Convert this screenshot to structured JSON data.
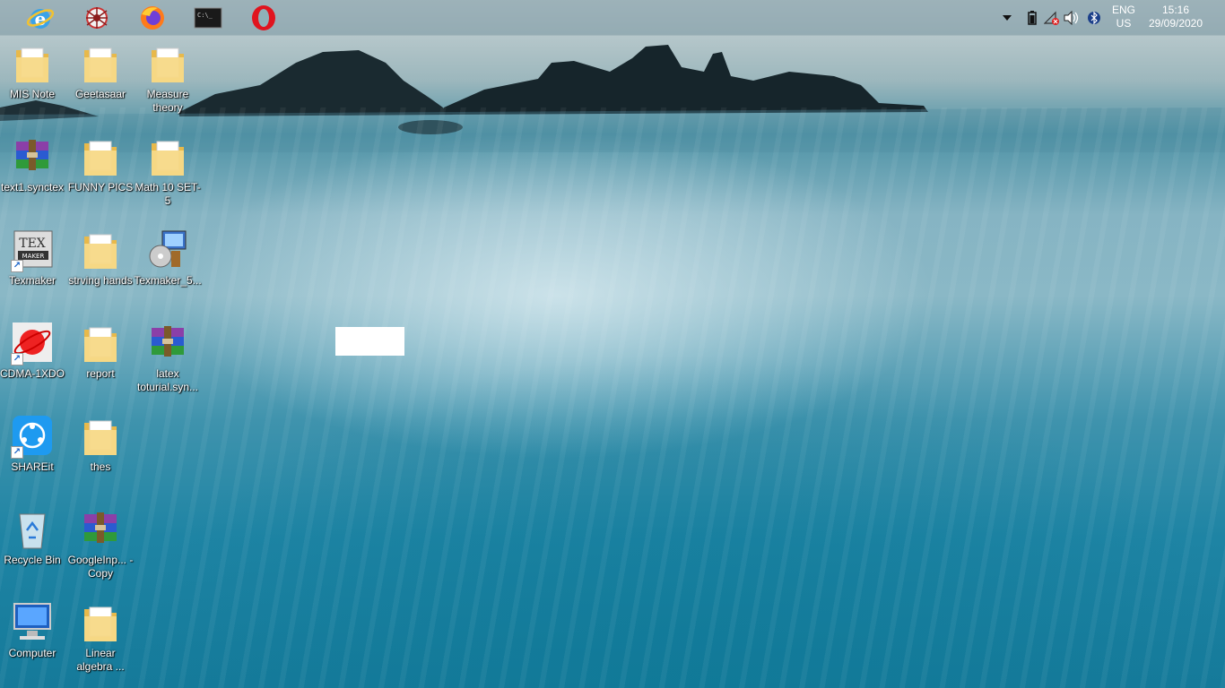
{
  "taskbar": {
    "apps": [
      {
        "name": "internet-explorer",
        "icon": "ie-icon"
      },
      {
        "name": "spider-app",
        "icon": "spider-icon"
      },
      {
        "name": "firefox",
        "icon": "firefox-icon"
      },
      {
        "name": "terminal",
        "icon": "terminal-icon"
      },
      {
        "name": "opera",
        "icon": "opera-icon"
      }
    ],
    "tray": {
      "icons": [
        "chevron-up-icon",
        "battery-icon",
        "network-disconnected-icon",
        "volume-icon",
        "bluetooth-icon"
      ],
      "lang_line1": "ENG",
      "lang_line2": "US",
      "time": "15:16",
      "date": "29/09/2020"
    }
  },
  "desktop": {
    "icons": [
      {
        "label": "MIS Note",
        "type": "folder"
      },
      {
        "label": "Geetasaar",
        "type": "folder"
      },
      {
        "label": "Measure theory",
        "type": "folder"
      },
      {
        "label": "text1.synctex",
        "type": "archive"
      },
      {
        "label": "FUNNY PICS",
        "type": "folder"
      },
      {
        "label": "Math 10 SET-5",
        "type": "folder"
      },
      {
        "label": "Texmaker",
        "type": "texmaker"
      },
      {
        "label": "strving hands",
        "type": "folder"
      },
      {
        "label": "Texmaker_5...",
        "type": "installer"
      },
      {
        "label": "CDMA-1XDO",
        "type": "cdma"
      },
      {
        "label": "report",
        "type": "folder"
      },
      {
        "label": "latex toturial.syn...",
        "type": "archive"
      },
      {
        "label": "SHAREit",
        "type": "shareit"
      },
      {
        "label": "thes",
        "type": "folder"
      },
      {
        "label": "Recycle Bin",
        "type": "recycle"
      },
      {
        "label": "GoogleInp... - Copy",
        "type": "archive"
      },
      {
        "label": "Computer",
        "type": "computer"
      },
      {
        "label": "Linear algebra ...",
        "type": "folder"
      }
    ]
  },
  "colors": {
    "taskbar": "#7896a0",
    "folder": "#f4d27a",
    "accent": "#1b63c8"
  }
}
